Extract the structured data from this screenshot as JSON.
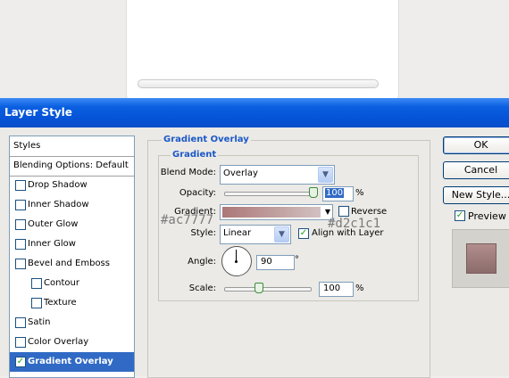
{
  "dialog": {
    "title": "Layer Style"
  },
  "styles_list": {
    "items": [
      {
        "label": "Styles",
        "checkbox": false,
        "checked": false,
        "selected": false
      },
      {
        "label": "Blending Options: Default",
        "checkbox": false,
        "checked": false,
        "selected": false
      },
      {
        "label": "Drop Shadow",
        "checkbox": true,
        "checked": false,
        "selected": false
      },
      {
        "label": "Inner Shadow",
        "checkbox": true,
        "checked": false,
        "selected": false
      },
      {
        "label": "Outer Glow",
        "checkbox": true,
        "checked": false,
        "selected": false
      },
      {
        "label": "Inner Glow",
        "checkbox": true,
        "checked": false,
        "selected": false
      },
      {
        "label": "Bevel and Emboss",
        "checkbox": true,
        "checked": false,
        "selected": false
      },
      {
        "label": "Contour",
        "checkbox": true,
        "checked": false,
        "selected": false,
        "indent": true
      },
      {
        "label": "Texture",
        "checkbox": true,
        "checked": false,
        "selected": false,
        "indent": true
      },
      {
        "label": "Satin",
        "checkbox": true,
        "checked": false,
        "selected": false
      },
      {
        "label": "Color Overlay",
        "checkbox": true,
        "checked": false,
        "selected": false
      },
      {
        "label": "Gradient Overlay",
        "checkbox": true,
        "checked": true,
        "selected": true
      }
    ]
  },
  "gradient_overlay": {
    "section_title": "Gradient Overlay",
    "group_title": "Gradient",
    "blend_mode_label": "Blend Mode:",
    "blend_mode_value": "Overlay",
    "opacity_label": "Opacity:",
    "opacity_value": "100",
    "opacity_unit": "%",
    "opacity_level": 1.0,
    "gradient_label": "Gradient:",
    "gradient_start_color": "#ac7777",
    "gradient_end_color": "#d2c1c1",
    "reverse_label": "Reverse",
    "reverse_checked": false,
    "style_label": "Style:",
    "style_value": "Linear",
    "align_label": "Align with Layer",
    "align_checked": true,
    "angle_label": "Angle:",
    "angle_value": "90",
    "angle_unit": "°",
    "scale_label": "Scale:",
    "scale_value": "100",
    "scale_unit": "%",
    "scale_level": 0.4
  },
  "annotations": {
    "start_color": "#ac7777",
    "end_color": "#d2c1c1"
  },
  "buttons": {
    "ok": "OK",
    "cancel": "Cancel",
    "new_style": "New Style..."
  },
  "preview": {
    "label": "Preview",
    "checked": true
  },
  "colors": {
    "titlebar": "#0553d6",
    "selection": "#316ac5",
    "group_title": "#1b58c7"
  }
}
